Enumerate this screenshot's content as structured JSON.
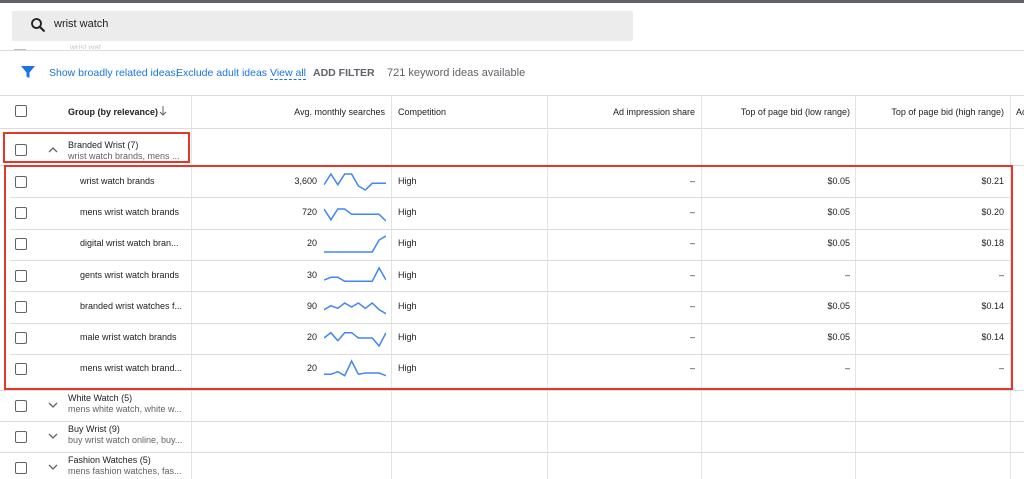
{
  "search": {
    "query": "wrist watch"
  },
  "hidden_row_text": "wrist wat...",
  "filter_bar": {
    "link1": "Show broadly related ideas;",
    "link2": "Exclude adult ideas",
    "view_all": "View all",
    "add_filter": "ADD FILTER",
    "count": "721 keyword ideas available"
  },
  "columns": {
    "group": "Group (by relevance)",
    "searches": "Avg. monthly searches",
    "competition": "Competition",
    "ad_impression": "Ad impression share",
    "bid_low": "Top of page bid (low range)",
    "bid_high": "Top of page bid (high range)",
    "extra": "Ac"
  },
  "expanded_group": {
    "name": "Branded Wrist (7)",
    "keywords": "wrist watch brands, mens ..."
  },
  "keywords": [
    {
      "keyword": "wrist watch brands",
      "searches": "3,600",
      "competition": "High",
      "ad_impression": "–",
      "bid_low": "$0.05",
      "bid_high": "$0.21",
      "trend": [
        4,
        12,
        4,
        12,
        12,
        3,
        0,
        5,
        5,
        5
      ]
    },
    {
      "keyword": "mens wrist watch brands",
      "searches": "720",
      "competition": "High",
      "ad_impression": "–",
      "bid_low": "$0.05",
      "bid_high": "$0.20",
      "trend": [
        9,
        1,
        9,
        9,
        5,
        5,
        5,
        5,
        5,
        0
      ]
    },
    {
      "keyword": "digital wrist watch bran...",
      "searches": "20",
      "competition": "High",
      "ad_impression": "–",
      "bid_low": "$0.05",
      "bid_high": "$0.18",
      "trend": [
        0,
        0,
        0,
        0,
        0,
        0,
        0,
        0,
        9,
        12
      ]
    },
    {
      "keyword": "gents wrist watch brands",
      "searches": "30",
      "competition": "High",
      "ad_impression": "–",
      "bid_low": "–",
      "bid_high": "–",
      "trend": [
        3,
        5,
        5,
        2,
        2,
        2,
        2,
        2,
        12,
        3
      ]
    },
    {
      "keyword": "branded wrist watches f...",
      "searches": "90",
      "competition": "High",
      "ad_impression": "–",
      "bid_low": "$0.05",
      "bid_high": "$0.14",
      "trend": [
        4,
        7,
        5,
        9,
        6,
        9,
        5,
        9,
        4,
        1
      ]
    },
    {
      "keyword": "male wrist watch brands",
      "searches": "20",
      "competition": "High",
      "ad_impression": "–",
      "bid_low": "$0.05",
      "bid_high": "$0.14",
      "trend": [
        6,
        10,
        4,
        10,
        10,
        6,
        6,
        6,
        0,
        10
      ]
    },
    {
      "keyword": "mens wrist watch brand...",
      "searches": "20",
      "competition": "High",
      "ad_impression": "–",
      "bid_low": "–",
      "bid_high": "–",
      "trend": [
        2,
        2,
        4,
        1,
        12,
        2,
        3,
        3,
        3,
        1
      ]
    }
  ],
  "collapsed_groups": [
    {
      "name": "White Watch (5)",
      "keywords": "mens white watch, white w..."
    },
    {
      "name": "Buy Wrist (9)",
      "keywords": "buy wrist watch online, buy..."
    },
    {
      "name": "Fashion Watches (5)",
      "keywords": "mens fashion watches, fas..."
    }
  ],
  "colors": {
    "accent": "#1a73e8",
    "highlight_border": "#e53727",
    "sparkline": "#4285f4"
  }
}
